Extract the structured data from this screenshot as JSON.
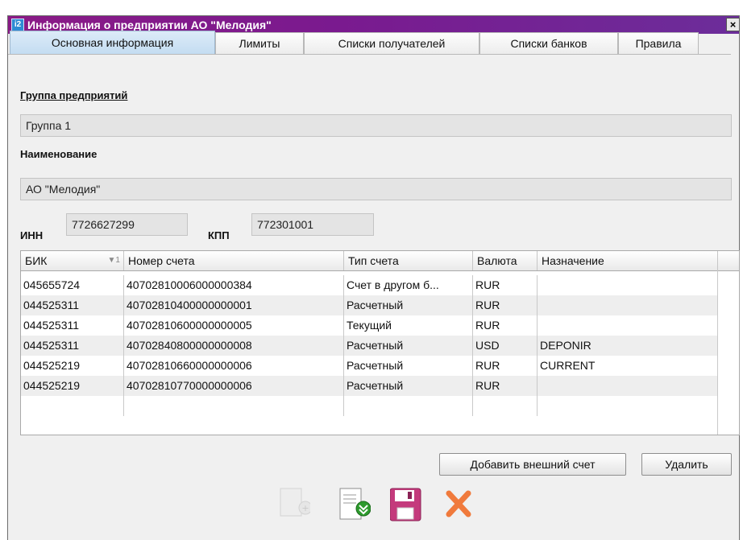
{
  "window": {
    "title": "Информация о предприятии АО \"Мелодия\"",
    "close_symbol": "×"
  },
  "tabs": [
    {
      "label": "Основная информация",
      "active": true
    },
    {
      "label": "Лимиты",
      "active": false
    },
    {
      "label": "Списки получателей",
      "active": false
    },
    {
      "label": "Списки банков",
      "active": false
    },
    {
      "label": "Правила",
      "active": false
    }
  ],
  "form": {
    "group_label": "Группа предприятий",
    "group_value": "Группа 1",
    "name_label": "Наименование",
    "name_value": "АО \"Мелодия\"",
    "inn_label": "ИНН",
    "inn_value": "7726627299",
    "kpp_label": "КПП",
    "kpp_value": "772301001"
  },
  "accounts_table": {
    "columns": [
      "БИК",
      "Номер счета",
      "Тип счета",
      "Валюта",
      "Назначение"
    ],
    "sort_indicator": "▼1",
    "rows": [
      [
        "045655724",
        "40702810006000000384",
        "Счет в другом б...",
        "RUR",
        ""
      ],
      [
        "044525311",
        "40702810400000000001",
        "Расчетный",
        "RUR",
        ""
      ],
      [
        "044525311",
        "40702810600000000005",
        "Текущий",
        "RUR",
        ""
      ],
      [
        "044525311",
        "40702840800000000008",
        "Расчетный",
        "USD",
        "DEPONIR"
      ],
      [
        "044525219",
        "40702810660000000006",
        "Расчетный",
        "RUR",
        "CURRENT"
      ],
      [
        "044525219",
        "40702810770000000006",
        "Расчетный",
        "RUR",
        ""
      ]
    ]
  },
  "buttons": {
    "add_external": "Добавить внешний счет",
    "delete": "Удалить"
  },
  "toolbar": {
    "icons": [
      "new-document-icon",
      "import-document-icon",
      "save-icon",
      "cancel-icon"
    ]
  },
  "colors": {
    "title_bar": "#7a1a8f",
    "active_tab": "#c3dcf1",
    "cancel": "#f07a3c"
  }
}
